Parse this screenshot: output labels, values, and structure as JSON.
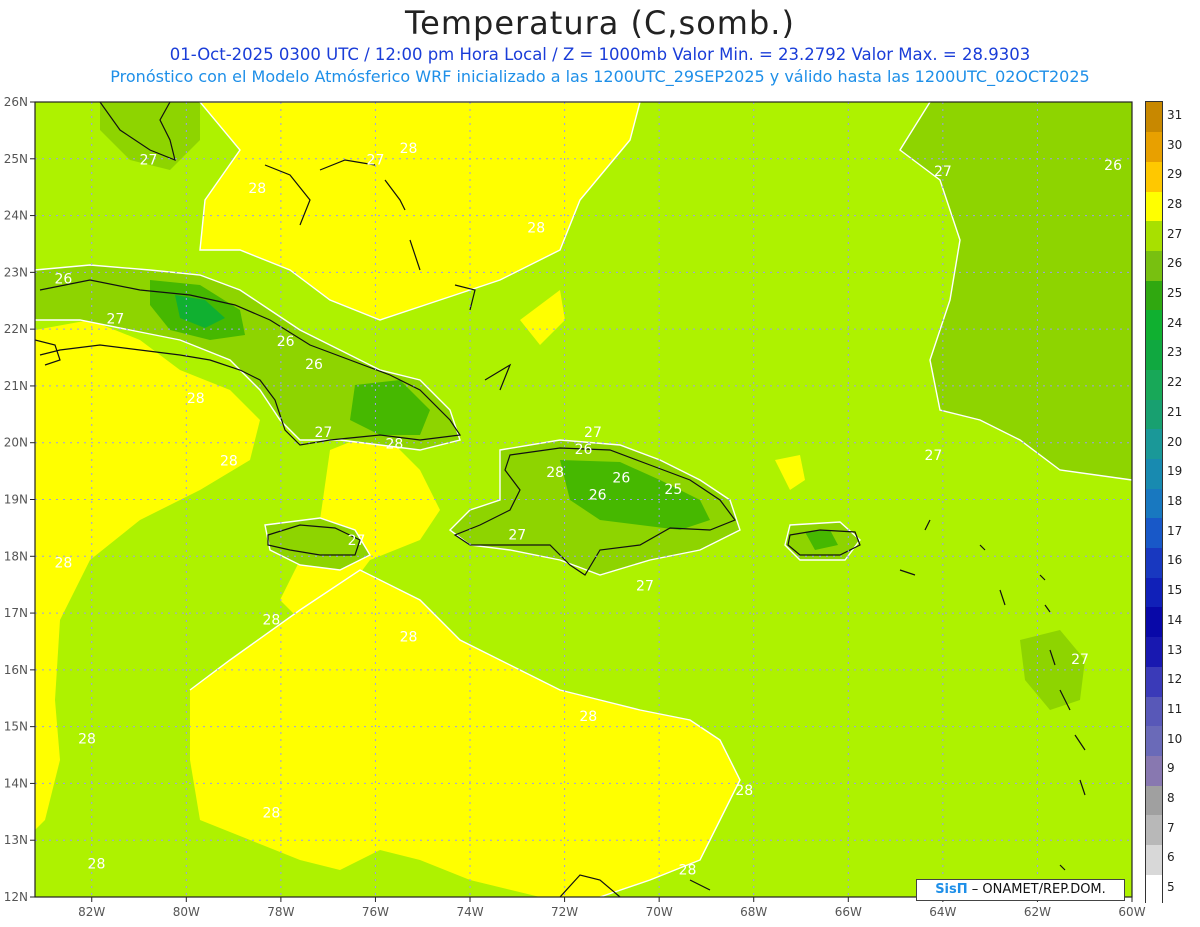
{
  "header": {
    "title": "Temperatura (C,somb.)",
    "line1": "01-Oct-2025 0300 UTC / 12:00 pm Hora Local / Z = 1000mb  Valor Min. = 23.2792  Valor Max. = 28.9303",
    "line2": "Pronóstico con el Modelo Atmósferico WRF inicializado a las 1200UTC_29SEP2025 y válido hasta las  1200UTC_02OCT2025"
  },
  "map": {
    "lon_range": [
      -83.2,
      -60
    ],
    "lat_range": [
      12,
      26
    ],
    "lon_ticks": [
      "82W",
      "80W",
      "78W",
      "76W",
      "74W",
      "72W",
      "70W",
      "68W",
      "66W",
      "64W",
      "62W",
      "60W"
    ],
    "lat_ticks": [
      "12N",
      "13N",
      "14N",
      "15N",
      "16N",
      "17N",
      "18N",
      "19N",
      "20N",
      "21N",
      "22N",
      "23N",
      "24N",
      "25N",
      "26N"
    ],
    "contour_labels": [
      {
        "text": "27",
        "lon": -80.8,
        "lat": 24.9
      },
      {
        "text": "27",
        "lon": -76.0,
        "lat": 24.9
      },
      {
        "text": "28",
        "lon": -75.3,
        "lat": 25.1
      },
      {
        "text": "28",
        "lon": -78.5,
        "lat": 24.4
      },
      {
        "text": "28",
        "lon": -72.6,
        "lat": 23.7
      },
      {
        "text": "26",
        "lon": -82.6,
        "lat": 22.8
      },
      {
        "text": "27",
        "lon": -81.5,
        "lat": 22.1
      },
      {
        "text": "26",
        "lon": -77.9,
        "lat": 21.7
      },
      {
        "text": "26",
        "lon": -77.3,
        "lat": 21.3
      },
      {
        "text": "28",
        "lon": -79.8,
        "lat": 20.7
      },
      {
        "text": "27",
        "lon": -77.1,
        "lat": 20.1
      },
      {
        "text": "28",
        "lon": -75.6,
        "lat": 19.9
      },
      {
        "text": "28",
        "lon": -79.1,
        "lat": 19.6
      },
      {
        "text": "27",
        "lon": -71.4,
        "lat": 20.1
      },
      {
        "text": "26",
        "lon": -71.6,
        "lat": 19.8
      },
      {
        "text": "26",
        "lon": -71.3,
        "lat": 19.0
      },
      {
        "text": "26",
        "lon": -70.8,
        "lat": 19.3
      },
      {
        "text": "25",
        "lon": -69.7,
        "lat": 19.1
      },
      {
        "text": "28",
        "lon": -72.2,
        "lat": 19.4
      },
      {
        "text": "27",
        "lon": -76.4,
        "lat": 18.2
      },
      {
        "text": "27",
        "lon": -73.0,
        "lat": 18.3
      },
      {
        "text": "27",
        "lon": -70.3,
        "lat": 17.4
      },
      {
        "text": "27",
        "lon": -64.0,
        "lat": 24.7
      },
      {
        "text": "26",
        "lon": -60.4,
        "lat": 24.8
      },
      {
        "text": "27",
        "lon": -64.2,
        "lat": 19.7
      },
      {
        "text": "28",
        "lon": -82.6,
        "lat": 17.8
      },
      {
        "text": "28",
        "lon": -78.2,
        "lat": 16.8
      },
      {
        "text": "28",
        "lon": -75.3,
        "lat": 16.5
      },
      {
        "text": "28",
        "lon": -71.5,
        "lat": 15.1
      },
      {
        "text": "28",
        "lon": -82.1,
        "lat": 14.7
      },
      {
        "text": "28",
        "lon": -78.2,
        "lat": 13.4
      },
      {
        "text": "28",
        "lon": -68.2,
        "lat": 13.8
      },
      {
        "text": "27",
        "lon": -61.1,
        "lat": 16.1
      },
      {
        "text": "28",
        "lon": -81.9,
        "lat": 12.5
      },
      {
        "text": "28",
        "lon": -69.4,
        "lat": 12.4
      }
    ]
  },
  "colorbar": {
    "labels": [
      "5",
      "6",
      "7",
      "8",
      "9",
      "10",
      "11",
      "12",
      "13",
      "14",
      "15",
      "16",
      "17",
      "18",
      "19",
      "20",
      "21",
      "22",
      "23",
      "24",
      "25",
      "26",
      "27",
      "28",
      "29",
      "30",
      "31"
    ],
    "colors": [
      "#ffffff",
      "#d8d8d8",
      "#b8b8b8",
      "#a0a0a0",
      "#8878b0",
      "#6a6ab8",
      "#5858b8",
      "#3a3ab8",
      "#1818b0",
      "#0808a8",
      "#1020b8",
      "#1838c0",
      "#1858c8",
      "#1878c0",
      "#188ab0",
      "#1a9898",
      "#18a070",
      "#18a858",
      "#10a840",
      "#10b030",
      "#30a810",
      "#78c010",
      "#a8e000",
      "#ffff00",
      "#ffc800",
      "#e8a000",
      "#c88800"
    ]
  },
  "credit": {
    "brand": "SisΠ",
    "text": "– ONAMET/REP.DOM."
  }
}
